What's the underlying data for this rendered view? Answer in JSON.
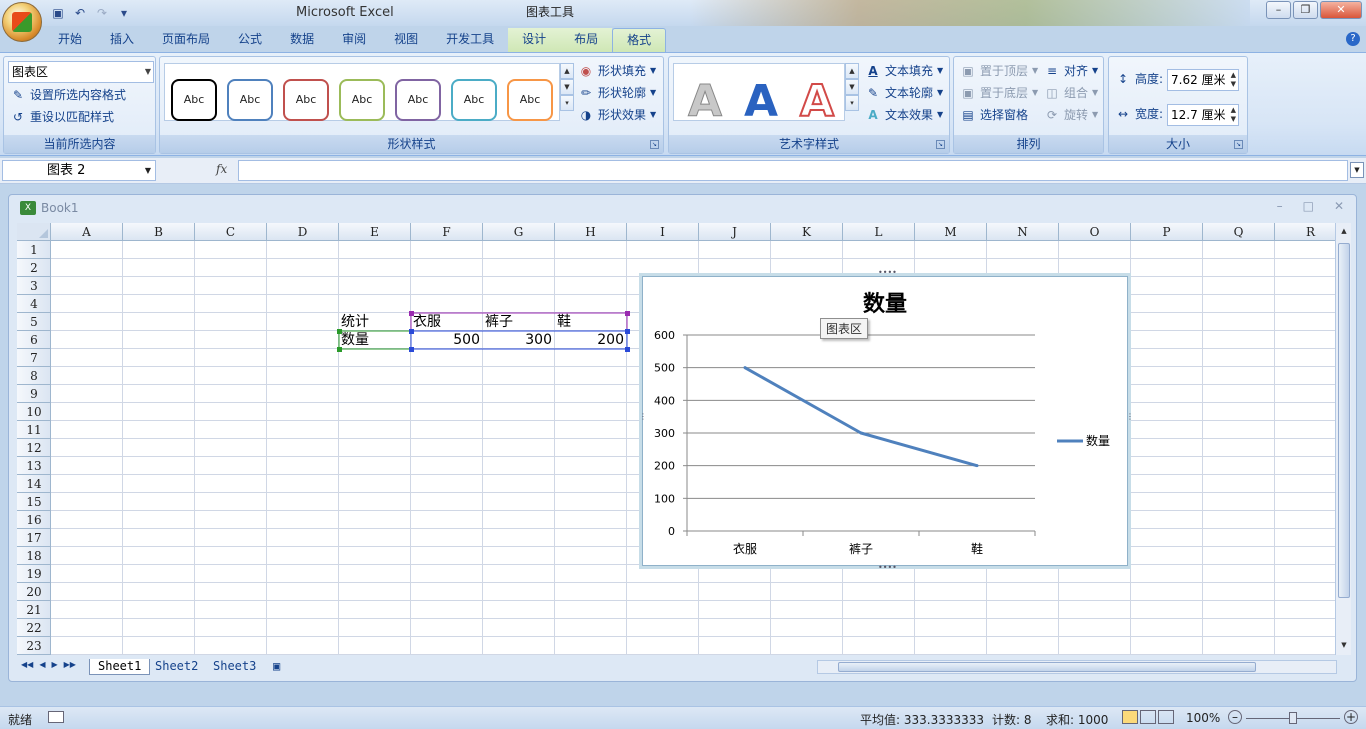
{
  "app": {
    "title": "Microsoft Excel",
    "context_title": "图表工具"
  },
  "ribbon_tabs": [
    "开始",
    "插入",
    "页面布局",
    "公式",
    "数据",
    "审阅",
    "视图",
    "开发工具",
    "设计",
    "布局",
    "格式"
  ],
  "active_tab": "格式",
  "current_selection": {
    "dropdown_value": "图表区",
    "format_selection": "设置所选内容格式",
    "reset_style": "重设以匹配样式",
    "label": "当前所选内容"
  },
  "shape_styles": {
    "swatches": [
      {
        "text": "Abc",
        "color": "#000000"
      },
      {
        "text": "Abc",
        "color": "#4f81bd"
      },
      {
        "text": "Abc",
        "color": "#c0504d"
      },
      {
        "text": "Abc",
        "color": "#9bbb59"
      },
      {
        "text": "Abc",
        "color": "#8064a2"
      },
      {
        "text": "Abc",
        "color": "#4bacc6"
      },
      {
        "text": "Abc",
        "color": "#f79646"
      }
    ],
    "fill": "形状填充",
    "outline": "形状轮廓",
    "effects": "形状效果",
    "label": "形状样式"
  },
  "wordart": {
    "letters": [
      "A",
      "A",
      "A"
    ],
    "text_fill": "文本填充",
    "text_outline": "文本轮廓",
    "text_effects": "文本效果",
    "label": "艺术字样式"
  },
  "arrange": {
    "bring_front": "置于顶层",
    "send_back": "置于底层",
    "selection_pane": "选择窗格",
    "align": "对齐",
    "group": "组合",
    "rotate": "旋转",
    "label": "排列"
  },
  "size": {
    "height_label": "高度:",
    "height_value": "7.62 厘米",
    "width_label": "宽度:",
    "width_value": "12.7 厘米",
    "label": "大小"
  },
  "formula_bar": {
    "name_box": "图表 2",
    "fx": "fx"
  },
  "workbook": {
    "title": "Book1",
    "columns": [
      "A",
      "B",
      "C",
      "D",
      "E",
      "F",
      "G",
      "H",
      "I",
      "J",
      "K",
      "L",
      "M",
      "N",
      "O",
      "P",
      "Q",
      "R"
    ],
    "rows": [
      "1",
      "2",
      "3",
      "4",
      "5",
      "6",
      "7",
      "8",
      "9",
      "10",
      "11",
      "12",
      "13",
      "14",
      "15",
      "16",
      "17",
      "18",
      "19",
      "20",
      "21",
      "22",
      "23"
    ],
    "cells": {
      "E5": "统计",
      "F5": "衣服",
      "G5": "裤子",
      "H5": "鞋",
      "E6": "数量",
      "F6": "500",
      "G6": "300",
      "H6": "200"
    },
    "sheets": [
      "Sheet1",
      "Sheet2",
      "Sheet3"
    ],
    "active_sheet": "Sheet1"
  },
  "chart_tooltip": "图表区",
  "chart_data": {
    "type": "line",
    "title": "数量",
    "categories": [
      "衣服",
      "裤子",
      "鞋"
    ],
    "series": [
      {
        "name": "数量",
        "values": [
          500,
          300,
          200
        ],
        "color": "#4f81bd"
      }
    ],
    "ylim": [
      0,
      600
    ],
    "yticks": [
      0,
      100,
      200,
      300,
      400,
      500,
      600
    ],
    "grid": true,
    "legend": "right"
  },
  "status": {
    "ready": "就绪",
    "average": "平均值: 333.3333333",
    "count": "计数: 8",
    "sum": "求和: 1000",
    "zoom": "100%"
  }
}
